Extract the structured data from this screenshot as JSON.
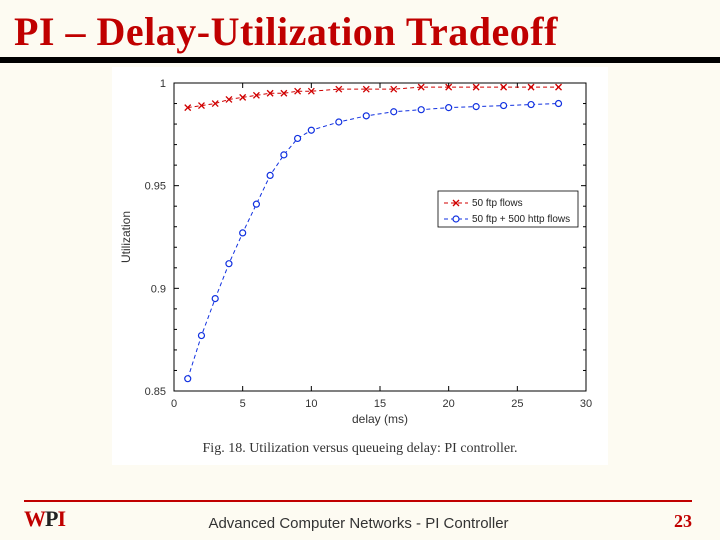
{
  "title": "PI – Delay-Utilization Tradeoff",
  "footer": {
    "logo_w": "W",
    "logo_p": "P",
    "logo_i": "I",
    "text": "Advanced Computer Networks -  PI Controller",
    "page": "23"
  },
  "chart_data": {
    "type": "line",
    "title": "",
    "xlabel": "delay (ms)",
    "ylabel": "Utilization",
    "xlim": [
      0,
      30
    ],
    "ylim": [
      0.85,
      1.0
    ],
    "xticks": [
      0,
      5,
      10,
      15,
      20,
      25,
      30
    ],
    "yticks": [
      0.85,
      0.9,
      0.95,
      1.0
    ],
    "yticklabels": [
      "0.85",
      "0.9",
      "0.95",
      "1"
    ],
    "legend": [
      "50 ftp flows",
      "50 ftp + 500 http flows"
    ],
    "x": [
      1,
      2,
      3,
      4,
      5,
      6,
      7,
      8,
      9,
      10,
      12,
      14,
      16,
      18,
      20,
      22,
      24,
      26,
      28
    ],
    "series": [
      {
        "name": "50 ftp flows",
        "marker": "x",
        "color": "#d00000",
        "values": [
          0.988,
          0.989,
          0.99,
          0.992,
          0.993,
          0.994,
          0.995,
          0.995,
          0.996,
          0.996,
          0.997,
          0.997,
          0.997,
          0.998,
          0.998,
          0.998,
          0.998,
          0.998,
          0.998
        ]
      },
      {
        "name": "50 ftp + 500 http flows",
        "marker": "o",
        "color": "#1030e0",
        "values": [
          0.856,
          0.877,
          0.895,
          0.912,
          0.927,
          0.941,
          0.955,
          0.965,
          0.973,
          0.977,
          0.981,
          0.984,
          0.986,
          0.987,
          0.988,
          0.9885,
          0.989,
          0.9895,
          0.99
        ]
      }
    ],
    "caption": "Fig. 18.   Utilization versus queueing delay: PI controller."
  }
}
